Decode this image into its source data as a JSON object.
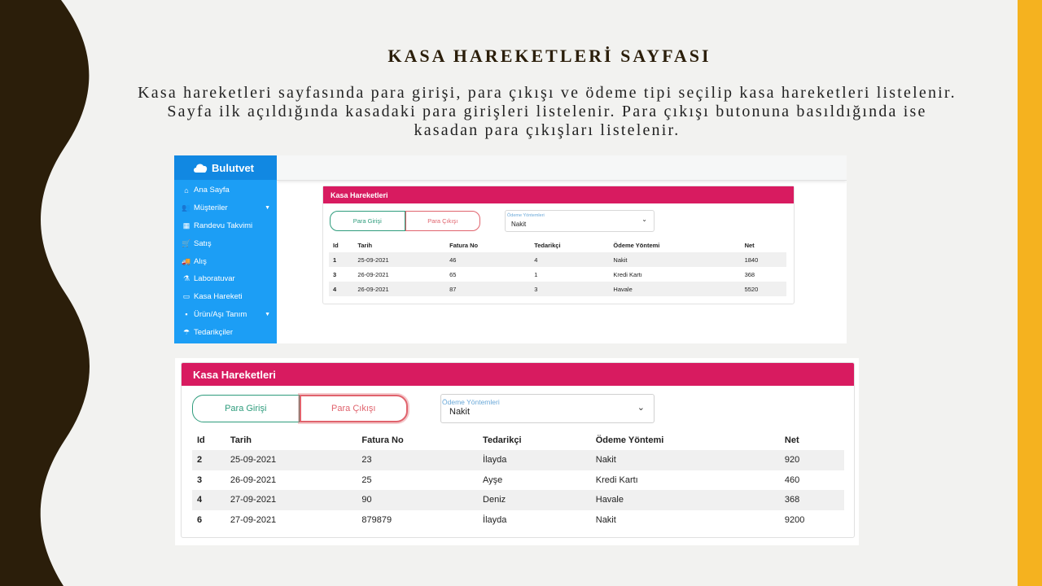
{
  "slide": {
    "title": "KASA HAREKETLERİ SAYFASI",
    "description": "Kasa hareketleri sayfasında para girişi, para çıkışı ve ödeme tipi seçilip kasa hareketleri listelenir. Sayfa ilk açıldığında kasadaki para girişleri listelenir. Para çıkışı butonuna basıldığında ise kasadan para çıkışları listelenir.",
    "colors": {
      "background": "#f2f2f0",
      "wave": "#2b1e0a",
      "accent": "#f5b21f"
    }
  },
  "screenshot1": {
    "brand": "Bulutvet",
    "sidebar": [
      {
        "icon": "home-icon",
        "glyph": "⌂",
        "label": "Ana Sayfa",
        "has_caret": false
      },
      {
        "icon": "users-icon",
        "glyph": "👥",
        "label": "Müşteriler",
        "has_caret": true
      },
      {
        "icon": "calendar-icon",
        "glyph": "▦",
        "label": "Randevu Takvimi",
        "has_caret": false
      },
      {
        "icon": "cart-icon",
        "glyph": "🛒",
        "label": "Satış",
        "has_caret": false
      },
      {
        "icon": "truck-icon",
        "glyph": "🚚",
        "label": "Alış",
        "has_caret": false
      },
      {
        "icon": "flask-icon",
        "glyph": "⚗",
        "label": "Laboratuvar",
        "has_caret": false
      },
      {
        "icon": "money-icon",
        "glyph": "▭",
        "label": "Kasa Hareketi",
        "has_caret": false
      },
      {
        "icon": "boxes-icon",
        "glyph": "▪",
        "label": "Ürün/Aşı Tanım",
        "has_caret": true
      },
      {
        "icon": "parachute-icon",
        "glyph": "☂",
        "label": "Tedarikçiler",
        "has_caret": false
      }
    ],
    "card_title": "Kasa Hareketleri",
    "buttons": {
      "in": "Para Girişi",
      "out": "Para Çıkışı"
    },
    "payment_select": {
      "label": "Ödeme Yöntemleri",
      "value": "Nakit"
    },
    "columns": [
      "Id",
      "Tarih",
      "Fatura No",
      "Tedarikçi",
      "Ödeme Yöntemi",
      "Net"
    ],
    "rows": [
      [
        "1",
        "25-09-2021",
        "46",
        "4",
        "Nakit",
        "1840"
      ],
      [
        "3",
        "26-09-2021",
        "65",
        "1",
        "Kredi Kartı",
        "368"
      ],
      [
        "4",
        "26-09-2021",
        "87",
        "3",
        "Havale",
        "5520"
      ]
    ],
    "colors": {
      "sidebar": "#1c9ef5",
      "header": "#d81b60",
      "in_button": "#2e9c7c",
      "out_button": "#e0636d"
    }
  },
  "screenshot2": {
    "card_title": "Kasa Hareketleri",
    "buttons": {
      "in": "Para Girişi",
      "out": "Para Çıkışı"
    },
    "payment_select": {
      "label": "Ödeme Yöntemleri",
      "value": "Nakit"
    },
    "columns": [
      "Id",
      "Tarih",
      "Fatura No",
      "Tedarikçi",
      "Ödeme Yöntemi",
      "Net"
    ],
    "rows": [
      [
        "2",
        "25-09-2021",
        "23",
        "İlayda",
        "Nakit",
        "920"
      ],
      [
        "3",
        "26-09-2021",
        "25",
        "Ayşe",
        "Kredi Kartı",
        "460"
      ],
      [
        "4",
        "27-09-2021",
        "90",
        "Deniz",
        "Havale",
        "368"
      ],
      [
        "6",
        "27-09-2021",
        "879879",
        "İlayda",
        "Nakit",
        "9200"
      ]
    ]
  }
}
